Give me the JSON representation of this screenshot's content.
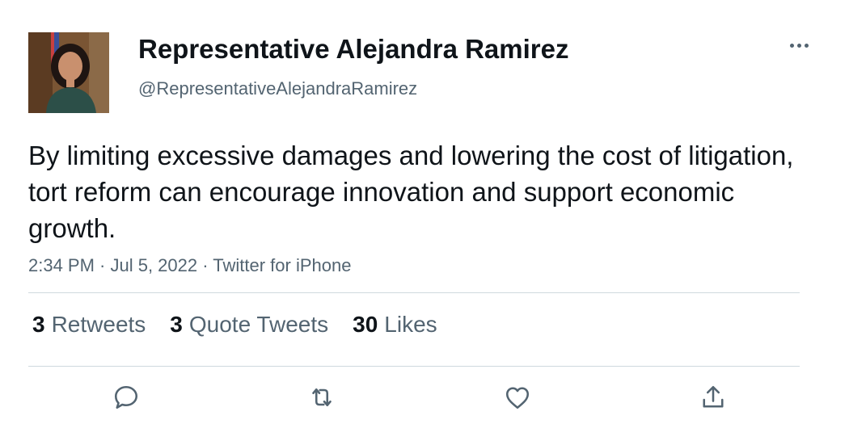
{
  "author": {
    "display_name": "Representative Alejandra Ramirez",
    "handle": "@RepresentativeAlejandraRamirez"
  },
  "tweet": {
    "text": "By limiting excessive damages and lowering the cost of litigation, tort reform can encourage innovation and support economic growth.",
    "meta": "2:34 PM · Jul 5, 2022 · Twitter for iPhone"
  },
  "stats": {
    "retweets_count": "3",
    "retweets_label": "Retweets",
    "quotes_count": "3",
    "quotes_label": "Quote Tweets",
    "likes_count": "30",
    "likes_label": "Likes"
  },
  "icons": {
    "more": "more-icon",
    "reply": "reply-icon",
    "retweet": "retweet-icon",
    "like": "heart-icon",
    "share": "share-icon"
  },
  "colors": {
    "text_primary": "#0f1419",
    "text_secondary": "#536471",
    "divider": "#cfd9de"
  }
}
